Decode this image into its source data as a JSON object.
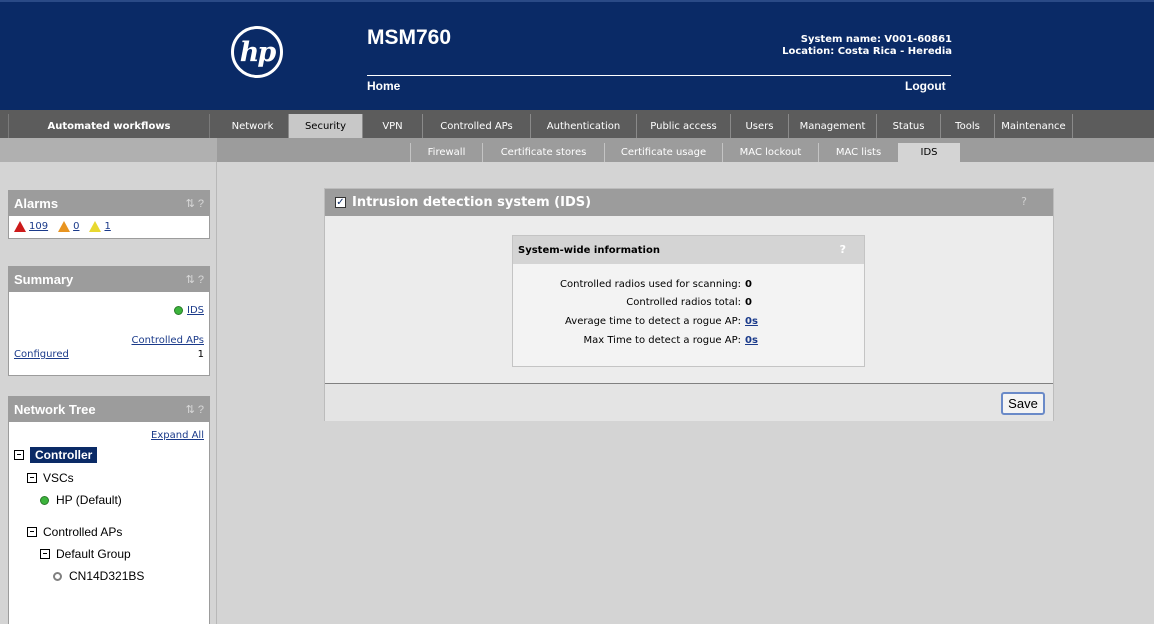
{
  "header": {
    "product": "MSM760",
    "home": "Home",
    "logout": "Logout",
    "system_name": "System name: V001-60861",
    "location": "Location: Costa Rica - Heredia",
    "logo_text": "hp"
  },
  "nav": {
    "workflows": "Automated workflows",
    "tabs": [
      {
        "label": "Network",
        "width": 72
      },
      {
        "label": "Security",
        "width": 74,
        "active": true
      },
      {
        "label": "VPN",
        "width": 60
      },
      {
        "label": "Controlled APs",
        "width": 108
      },
      {
        "label": "Authentication",
        "width": 106
      },
      {
        "label": "Public access",
        "width": 94
      },
      {
        "label": "Users",
        "width": 58
      },
      {
        "label": "Management",
        "width": 88
      },
      {
        "label": "Status",
        "width": 64
      },
      {
        "label": "Tools",
        "width": 54
      },
      {
        "label": "Maintenance",
        "width": 78
      }
    ],
    "subtabs": [
      {
        "label": "Firewall",
        "width": 72
      },
      {
        "label": "Certificate stores",
        "width": 122
      },
      {
        "label": "Certificate usage",
        "width": 118
      },
      {
        "label": "MAC lockout",
        "width": 96
      },
      {
        "label": "MAC lists",
        "width": 80
      },
      {
        "label": "IDS",
        "width": 62,
        "active": true
      }
    ]
  },
  "sidebar": {
    "alarms": {
      "title": "Alarms",
      "critical": "109",
      "major": "0",
      "minor": "1"
    },
    "summary": {
      "title": "Summary",
      "ids_link": "IDS",
      "controlled_aps_link": "Controlled APs",
      "configured_label": "Configured",
      "configured_count": "1"
    },
    "tree": {
      "title": "Network Tree",
      "expand_all": "Expand All",
      "controller": "Controller",
      "vscs": "VSCs",
      "vsc_item": "HP (Default)",
      "controlled_aps": "Controlled APs",
      "default_group": "Default Group",
      "ap_item": "CN14D321BS"
    },
    "panel_tools": "⇅ ?"
  },
  "content": {
    "title": "Intrusion detection system (IDS)",
    "help": "?",
    "info_title": "System-wide information",
    "rows": [
      {
        "label": "Controlled radios used for scanning:",
        "value": "0"
      },
      {
        "label": "Controlled radios total:",
        "value": "0"
      },
      {
        "label": "Average time to detect a rogue AP:",
        "value": "0s"
      },
      {
        "label": "Max Time to detect a rogue AP:",
        "value": "0s"
      }
    ],
    "save": "Save"
  }
}
